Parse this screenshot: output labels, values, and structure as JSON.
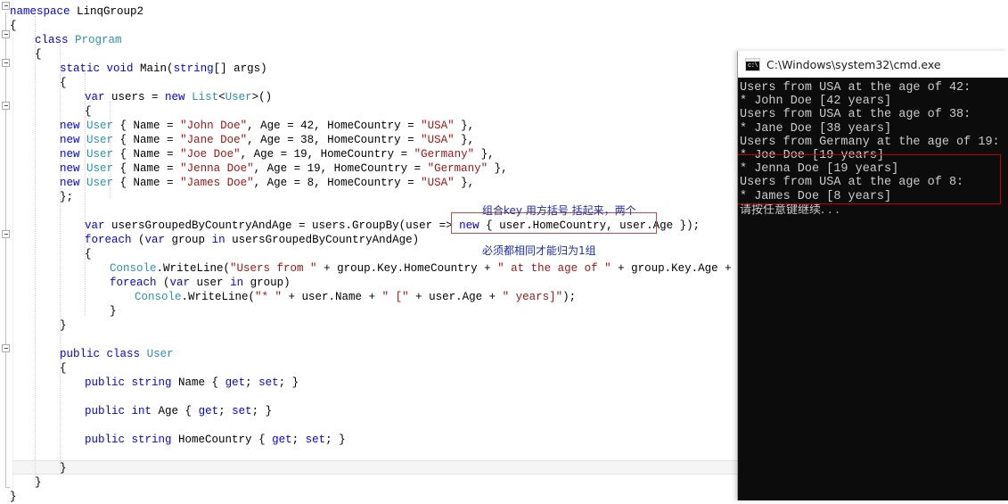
{
  "editor": {
    "language": "csharp",
    "code_lines": [
      {
        "indent": 0,
        "tokens": [
          {
            "t": "kw",
            "s": "namespace"
          },
          {
            "t": "pln",
            "s": " LinqGroup2"
          }
        ]
      },
      {
        "indent": 0,
        "tokens": [
          {
            "t": "pln",
            "s": "{"
          }
        ]
      },
      {
        "indent": 1,
        "tokens": [
          {
            "t": "kw",
            "s": "class"
          },
          {
            "t": "pln",
            "s": " "
          },
          {
            "t": "type",
            "s": "Program"
          }
        ]
      },
      {
        "indent": 1,
        "tokens": [
          {
            "t": "pln",
            "s": "{"
          }
        ]
      },
      {
        "indent": 2,
        "tokens": [
          {
            "t": "kw",
            "s": "static"
          },
          {
            "t": "pln",
            "s": " "
          },
          {
            "t": "kw",
            "s": "void"
          },
          {
            "t": "pln",
            "s": " Main("
          },
          {
            "t": "kw",
            "s": "string"
          },
          {
            "t": "pln",
            "s": "[] args)"
          }
        ]
      },
      {
        "indent": 2,
        "tokens": [
          {
            "t": "pln",
            "s": "{"
          }
        ]
      },
      {
        "indent": 3,
        "tokens": [
          {
            "t": "kw",
            "s": "var"
          },
          {
            "t": "pln",
            "s": " users = "
          },
          {
            "t": "kw",
            "s": "new"
          },
          {
            "t": "pln",
            "s": " "
          },
          {
            "t": "type",
            "s": "List"
          },
          {
            "t": "pln",
            "s": "<"
          },
          {
            "t": "type",
            "s": "User"
          },
          {
            "t": "pln",
            "s": ">()"
          }
        ]
      },
      {
        "indent": 3,
        "tokens": [
          {
            "t": "pln",
            "s": "{"
          }
        ]
      },
      {
        "indent": 2,
        "tokens": [
          {
            "t": "kw",
            "s": "new"
          },
          {
            "t": "pln",
            "s": " "
          },
          {
            "t": "type",
            "s": "User"
          },
          {
            "t": "pln",
            "s": " { Name = "
          },
          {
            "t": "str",
            "s": "\"John Doe\""
          },
          {
            "t": "pln",
            "s": ", Age = 42, HomeCountry = "
          },
          {
            "t": "str",
            "s": "\"USA\""
          },
          {
            "t": "pln",
            "s": " },"
          }
        ]
      },
      {
        "indent": 2,
        "tokens": [
          {
            "t": "kw",
            "s": "new"
          },
          {
            "t": "pln",
            "s": " "
          },
          {
            "t": "type",
            "s": "User"
          },
          {
            "t": "pln",
            "s": " { Name = "
          },
          {
            "t": "str",
            "s": "\"Jane Doe\""
          },
          {
            "t": "pln",
            "s": ", Age = 38, HomeCountry = "
          },
          {
            "t": "str",
            "s": "\"USA\""
          },
          {
            "t": "pln",
            "s": " },"
          }
        ]
      },
      {
        "indent": 2,
        "tokens": [
          {
            "t": "kw",
            "s": "new"
          },
          {
            "t": "pln",
            "s": " "
          },
          {
            "t": "type",
            "s": "User"
          },
          {
            "t": "pln",
            "s": " { Name = "
          },
          {
            "t": "str",
            "s": "\"Joe Doe\""
          },
          {
            "t": "pln",
            "s": ", Age = 19, HomeCountry = "
          },
          {
            "t": "str",
            "s": "\"Germany\""
          },
          {
            "t": "pln",
            "s": " },"
          }
        ]
      },
      {
        "indent": 2,
        "tokens": [
          {
            "t": "kw",
            "s": "new"
          },
          {
            "t": "pln",
            "s": " "
          },
          {
            "t": "type",
            "s": "User"
          },
          {
            "t": "pln",
            "s": " { Name = "
          },
          {
            "t": "str",
            "s": "\"Jenna Doe\""
          },
          {
            "t": "pln",
            "s": ", Age = 19, HomeCountry = "
          },
          {
            "t": "str",
            "s": "\"Germany\""
          },
          {
            "t": "pln",
            "s": " },"
          }
        ]
      },
      {
        "indent": 2,
        "tokens": [
          {
            "t": "kw",
            "s": "new"
          },
          {
            "t": "pln",
            "s": " "
          },
          {
            "t": "type",
            "s": "User"
          },
          {
            "t": "pln",
            "s": " { Name = "
          },
          {
            "t": "str",
            "s": "\"James Doe\""
          },
          {
            "t": "pln",
            "s": ", Age = 8, HomeCountry = "
          },
          {
            "t": "str",
            "s": "\"USA\""
          },
          {
            "t": "pln",
            "s": " },"
          }
        ]
      },
      {
        "indent": 2,
        "tokens": [
          {
            "t": "pln",
            "s": "};"
          }
        ]
      },
      {
        "indent": 0,
        "tokens": []
      },
      {
        "indent": 3,
        "tokens": [
          {
            "t": "kw",
            "s": "var"
          },
          {
            "t": "pln",
            "s": " usersGroupedByCountryAndAge = users.GroupBy(user => "
          },
          {
            "t": "kw",
            "s": "new"
          },
          {
            "t": "pln",
            "s": " { user.HomeCountry, user.Age });"
          }
        ]
      },
      {
        "indent": 3,
        "tokens": [
          {
            "t": "kw",
            "s": "foreach"
          },
          {
            "t": "pln",
            "s": " ("
          },
          {
            "t": "kw",
            "s": "var"
          },
          {
            "t": "pln",
            "s": " group "
          },
          {
            "t": "kw",
            "s": "in"
          },
          {
            "t": "pln",
            "s": " usersGroupedByCountryAndAge)"
          }
        ]
      },
      {
        "indent": 3,
        "tokens": [
          {
            "t": "pln",
            "s": "{"
          }
        ]
      },
      {
        "indent": 4,
        "tokens": [
          {
            "t": "type",
            "s": "Console"
          },
          {
            "t": "pln",
            "s": ".WriteLine("
          },
          {
            "t": "str",
            "s": "\"Users from \""
          },
          {
            "t": "pln",
            "s": " + group.Key.HomeCountry + "
          },
          {
            "t": "str",
            "s": "\" at the age of \""
          },
          {
            "t": "pln",
            "s": " + group.Key.Age + "
          },
          {
            "t": "str",
            "s": "\":\""
          },
          {
            "t": "pln",
            "s": ");"
          }
        ]
      },
      {
        "indent": 4,
        "tokens": [
          {
            "t": "kw",
            "s": "foreach"
          },
          {
            "t": "pln",
            "s": " ("
          },
          {
            "t": "kw",
            "s": "var"
          },
          {
            "t": "pln",
            "s": " user "
          },
          {
            "t": "kw",
            "s": "in"
          },
          {
            "t": "pln",
            "s": " group)"
          }
        ]
      },
      {
        "indent": 5,
        "tokens": [
          {
            "t": "type",
            "s": "Console"
          },
          {
            "t": "pln",
            "s": ".WriteLine("
          },
          {
            "t": "str",
            "s": "\"* \""
          },
          {
            "t": "pln",
            "s": " + user.Name + "
          },
          {
            "t": "str",
            "s": "\" [\""
          },
          {
            "t": "pln",
            "s": " + user.Age + "
          },
          {
            "t": "str",
            "s": "\" years]\""
          },
          {
            "t": "pln",
            "s": ");"
          }
        ]
      },
      {
        "indent": 4,
        "tokens": [
          {
            "t": "pln",
            "s": "}"
          }
        ]
      },
      {
        "indent": 2,
        "tokens": [
          {
            "t": "pln",
            "s": "}"
          }
        ]
      },
      {
        "indent": 0,
        "tokens": []
      },
      {
        "indent": 2,
        "tokens": [
          {
            "t": "kw",
            "s": "public"
          },
          {
            "t": "pln",
            "s": " "
          },
          {
            "t": "kw",
            "s": "class"
          },
          {
            "t": "pln",
            "s": " "
          },
          {
            "t": "type",
            "s": "User"
          }
        ]
      },
      {
        "indent": 2,
        "tokens": [
          {
            "t": "pln",
            "s": "{"
          }
        ]
      },
      {
        "indent": 3,
        "tokens": [
          {
            "t": "kw",
            "s": "public"
          },
          {
            "t": "pln",
            "s": " "
          },
          {
            "t": "kw",
            "s": "string"
          },
          {
            "t": "pln",
            "s": " Name { "
          },
          {
            "t": "kw",
            "s": "get"
          },
          {
            "t": "pln",
            "s": "; "
          },
          {
            "t": "kw",
            "s": "set"
          },
          {
            "t": "pln",
            "s": "; }"
          }
        ]
      },
      {
        "indent": 0,
        "tokens": []
      },
      {
        "indent": 3,
        "tokens": [
          {
            "t": "kw",
            "s": "public"
          },
          {
            "t": "pln",
            "s": " "
          },
          {
            "t": "kw",
            "s": "int"
          },
          {
            "t": "pln",
            "s": " Age { "
          },
          {
            "t": "kw",
            "s": "get"
          },
          {
            "t": "pln",
            "s": "; "
          },
          {
            "t": "kw",
            "s": "set"
          },
          {
            "t": "pln",
            "s": "; }"
          }
        ]
      },
      {
        "indent": 0,
        "tokens": []
      },
      {
        "indent": 3,
        "tokens": [
          {
            "t": "kw",
            "s": "public"
          },
          {
            "t": "pln",
            "s": " "
          },
          {
            "t": "kw",
            "s": "string"
          },
          {
            "t": "pln",
            "s": " HomeCountry { "
          },
          {
            "t": "kw",
            "s": "get"
          },
          {
            "t": "pln",
            "s": "; "
          },
          {
            "t": "kw",
            "s": "set"
          },
          {
            "t": "pln",
            "s": "; }"
          }
        ]
      },
      {
        "indent": 0,
        "tokens": []
      },
      {
        "indent": 2,
        "tokens": [
          {
            "t": "pln",
            "s": "}"
          }
        ]
      },
      {
        "indent": 1,
        "tokens": [
          {
            "t": "pln",
            "s": "}"
          }
        ]
      },
      {
        "indent": 0,
        "tokens": [
          {
            "t": "pln",
            "s": "}"
          }
        ]
      }
    ],
    "annotation": {
      "line1": "组合key 用方括号 括起来，两个",
      "line2": "必须都相同才能归为1组",
      "color": "#1f2ea8"
    },
    "highlight_box_color": "#c0504d",
    "current_line_index": 32
  },
  "console": {
    "title": "C:\\Windows\\system32\\cmd.exe",
    "icon": "cmd-icon",
    "prompt_glyph": "c:\\",
    "background": "#0c0c0c",
    "foreground": "#cccccc",
    "highlight_box_color": "#c00000",
    "output_lines": [
      {
        "text": "Users from USA at the age of 42:",
        "cjk": false
      },
      {
        "text": "* John Doe [42 years]",
        "cjk": false
      },
      {
        "text": "Users from USA at the age of 38:",
        "cjk": false
      },
      {
        "text": "* Jane Doe [38 years]",
        "cjk": false
      },
      {
        "text": "Users from Germany at the age of 19:",
        "cjk": false
      },
      {
        "text": "* Joe Doe [19 years]",
        "cjk": false
      },
      {
        "text": "* Jenna Doe [19 years]",
        "cjk": false
      },
      {
        "text": "Users from USA at the age of 8:",
        "cjk": false
      },
      {
        "text": "* James Doe [8 years]",
        "cjk": false
      },
      {
        "text": "请按任意键继续. . .",
        "cjk": true
      }
    ]
  }
}
